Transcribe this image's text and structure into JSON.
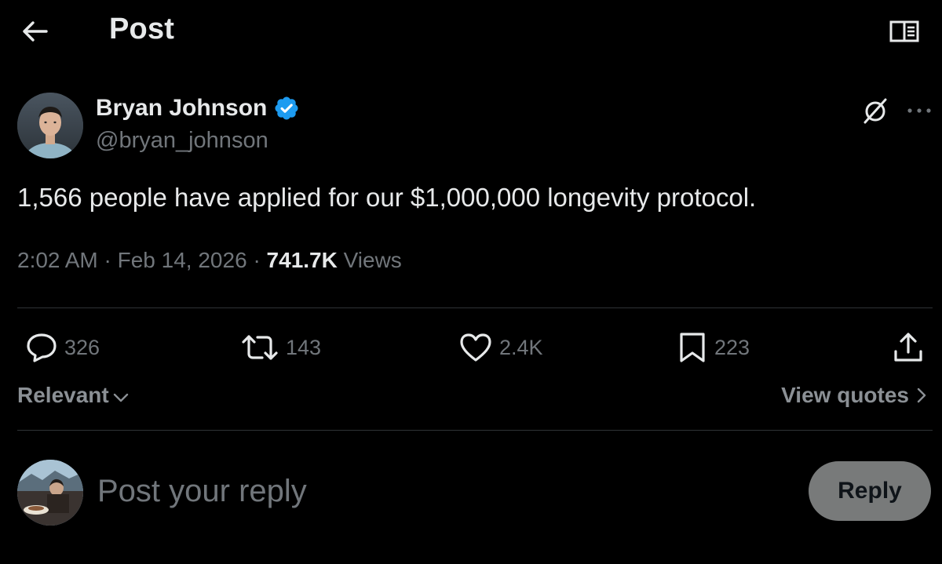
{
  "header": {
    "title": "Post",
    "back_icon": "arrow-left-icon",
    "reader_icon": "open-book-icon"
  },
  "author": {
    "name": "Bryan Johnson",
    "handle": "@bryan_johnson",
    "verified": true,
    "verified_color": "#1d9bf0"
  },
  "post": {
    "text": "1,566 people have applied for our $1,000,000 longevity protocol.",
    "time": "2:02 AM",
    "date": "Feb 14, 2026",
    "views_count": "741.7K",
    "views_label": "Views",
    "separator": "·"
  },
  "actions": {
    "replies": "326",
    "reposts": "143",
    "likes": "2.4K",
    "bookmarks": "223"
  },
  "replies_bar": {
    "sort_label": "Relevant",
    "quotes_label": "View quotes"
  },
  "composer": {
    "placeholder": "Post your reply",
    "button_label": "Reply"
  },
  "colors": {
    "background": "#000000",
    "text_primary": "#e7e9ea",
    "text_secondary": "#71767b",
    "divider": "#2f3336",
    "reply_button_bg": "#787a7a"
  }
}
